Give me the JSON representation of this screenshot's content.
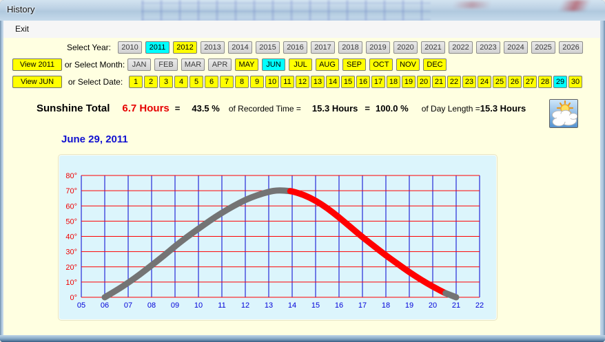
{
  "window": {
    "title": "History",
    "menu": [
      {
        "label": "Exit"
      }
    ]
  },
  "controls": {
    "year_label": "Select Year:",
    "years": [
      {
        "label": "2010",
        "state": "gray"
      },
      {
        "label": "2011",
        "state": "cyan"
      },
      {
        "label": "2012",
        "state": "yellow"
      },
      {
        "label": "2013",
        "state": "gray"
      },
      {
        "label": "2014",
        "state": "gray"
      },
      {
        "label": "2015",
        "state": "gray"
      },
      {
        "label": "2016",
        "state": "gray"
      },
      {
        "label": "2017",
        "state": "gray"
      },
      {
        "label": "2018",
        "state": "gray"
      },
      {
        "label": "2019",
        "state": "gray"
      },
      {
        "label": "2020",
        "state": "gray"
      },
      {
        "label": "2021",
        "state": "gray"
      },
      {
        "label": "2022",
        "state": "gray"
      },
      {
        "label": "2023",
        "state": "gray"
      },
      {
        "label": "2024",
        "state": "gray"
      },
      {
        "label": "2025",
        "state": "gray"
      },
      {
        "label": "2026",
        "state": "gray"
      }
    ],
    "view_year_button": "View 2011",
    "month_label": "or Select Month:",
    "months": [
      {
        "label": "JAN",
        "state": "gray"
      },
      {
        "label": "FEB",
        "state": "gray"
      },
      {
        "label": "MAR",
        "state": "gray"
      },
      {
        "label": "APR",
        "state": "gray"
      },
      {
        "label": "MAY",
        "state": "yellow"
      },
      {
        "label": "JUN",
        "state": "cyan"
      },
      {
        "label": "JUL",
        "state": "yellow"
      },
      {
        "label": "AUG",
        "state": "yellow"
      },
      {
        "label": "SEP",
        "state": "yellow"
      },
      {
        "label": "OCT",
        "state": "yellow"
      },
      {
        "label": "NOV",
        "state": "yellow"
      },
      {
        "label": "DEC",
        "state": "yellow"
      }
    ],
    "view_month_button": "View JUN",
    "date_label": "or Select Date:",
    "dates": [
      {
        "label": "1",
        "state": "yellow"
      },
      {
        "label": "2",
        "state": "yellow"
      },
      {
        "label": "3",
        "state": "yellow"
      },
      {
        "label": "4",
        "state": "yellow"
      },
      {
        "label": "5",
        "state": "yellow"
      },
      {
        "label": "6",
        "state": "yellow"
      },
      {
        "label": "7",
        "state": "yellow"
      },
      {
        "label": "8",
        "state": "yellow"
      },
      {
        "label": "9",
        "state": "yellow"
      },
      {
        "label": "10",
        "state": "yellow"
      },
      {
        "label": "11",
        "state": "yellow"
      },
      {
        "label": "12",
        "state": "yellow"
      },
      {
        "label": "13",
        "state": "yellow"
      },
      {
        "label": "14",
        "state": "yellow"
      },
      {
        "label": "15",
        "state": "yellow"
      },
      {
        "label": "16",
        "state": "yellow"
      },
      {
        "label": "17",
        "state": "yellow"
      },
      {
        "label": "18",
        "state": "yellow"
      },
      {
        "label": "19",
        "state": "yellow"
      },
      {
        "label": "20",
        "state": "yellow"
      },
      {
        "label": "21",
        "state": "yellow"
      },
      {
        "label": "22",
        "state": "yellow"
      },
      {
        "label": "23",
        "state": "yellow"
      },
      {
        "label": "24",
        "state": "yellow"
      },
      {
        "label": "25",
        "state": "yellow"
      },
      {
        "label": "26",
        "state": "yellow"
      },
      {
        "label": "27",
        "state": "yellow"
      },
      {
        "label": "28",
        "state": "yellow"
      },
      {
        "label": "29",
        "state": "cyan"
      },
      {
        "label": "30",
        "state": "yellow"
      }
    ]
  },
  "summary": {
    "items": [
      {
        "text": "Sunshine Total",
        "style": "title"
      },
      {
        "text": "6.7 Hours",
        "style": "red"
      },
      {
        "text": "=",
        "style": "eq"
      },
      {
        "text": "43.5 %",
        "style": "val"
      },
      {
        "text": "of Recorded Time =",
        "style": "conn"
      },
      {
        "text": "15.3 Hours",
        "style": "val"
      },
      {
        "text": "=",
        "style": "eq"
      },
      {
        "text": "100.0 %",
        "style": "val"
      },
      {
        "text": "of Day Length =",
        "style": "conn"
      },
      {
        "text": "15.3 Hours",
        "style": "val"
      }
    ],
    "weather_icon": "sun-behind-clouds"
  },
  "colors": {
    "selected": "#00FFFF",
    "available": "#FFFF00",
    "sunshine_red": "#FF0000",
    "no_sunshine_gray": "#747474",
    "content_bg": "#FFFFE1",
    "chart_bg": "#DCF5FC"
  },
  "chart_data": {
    "type": "line",
    "title": "June 29, 2011",
    "title_color": "#1010D0",
    "x_range": [
      5,
      22
    ],
    "y_range": [
      0,
      80
    ],
    "x_ticks": [
      5,
      6,
      7,
      8,
      9,
      10,
      11,
      12,
      13,
      14,
      15,
      16,
      17,
      18,
      19,
      20,
      21,
      22
    ],
    "x_tick_labels": [
      "05",
      "06",
      "07",
      "08",
      "09",
      "10",
      "11",
      "12",
      "13",
      "14",
      "15",
      "16",
      "17",
      "18",
      "19",
      "20",
      "21",
      "22"
    ],
    "y_ticks": [
      0,
      10,
      20,
      30,
      40,
      50,
      60,
      70,
      80
    ],
    "y_tick_labels": [
      "0°",
      "10°",
      "20°",
      "30°",
      "40°",
      "50°",
      "60°",
      "70°",
      "80°"
    ],
    "grid": {
      "on": true,
      "horizontal_color": "#FF0000",
      "vertical_color": "#0000D0"
    },
    "x_label_color": "#0000D8",
    "y_label_color": "#F00000",
    "stroke_width": 9,
    "series_name": "solar-elevation-degrees-vs-hour",
    "segments": [
      {
        "name": "no-sunshine-morning",
        "color": "#747474",
        "from": 6,
        "to": 13.92
      },
      {
        "name": "sunshine-recorded",
        "color": "#FF0000",
        "from": 13.92,
        "to": 20.55
      },
      {
        "name": "no-sunshine-evening",
        "color": "#747474",
        "from": 20.55,
        "to": 21
      }
    ],
    "elevation_profile": [
      [
        6,
        0
      ],
      [
        6.5,
        4.5
      ],
      [
        7,
        9.5
      ],
      [
        7.5,
        15
      ],
      [
        8,
        21
      ],
      [
        8.5,
        27
      ],
      [
        9,
        33.5
      ],
      [
        9.5,
        39.5
      ],
      [
        10,
        45
      ],
      [
        10.5,
        50.5
      ],
      [
        11,
        55.5
      ],
      [
        11.5,
        60
      ],
      [
        12,
        64
      ],
      [
        12.5,
        67
      ],
      [
        13,
        69.3
      ],
      [
        13.4,
        70.4
      ],
      [
        14,
        69.6
      ],
      [
        14.5,
        67.3
      ],
      [
        15,
        63.5
      ],
      [
        15.5,
        58.5
      ],
      [
        16,
        52.5
      ],
      [
        16.5,
        46
      ],
      [
        17,
        39.5
      ],
      [
        17.5,
        33.5
      ],
      [
        18,
        27.5
      ],
      [
        18.5,
        22
      ],
      [
        19,
        16.5
      ],
      [
        19.5,
        11.5
      ],
      [
        20,
        7
      ],
      [
        20.5,
        3
      ],
      [
        21,
        0
      ]
    ]
  }
}
